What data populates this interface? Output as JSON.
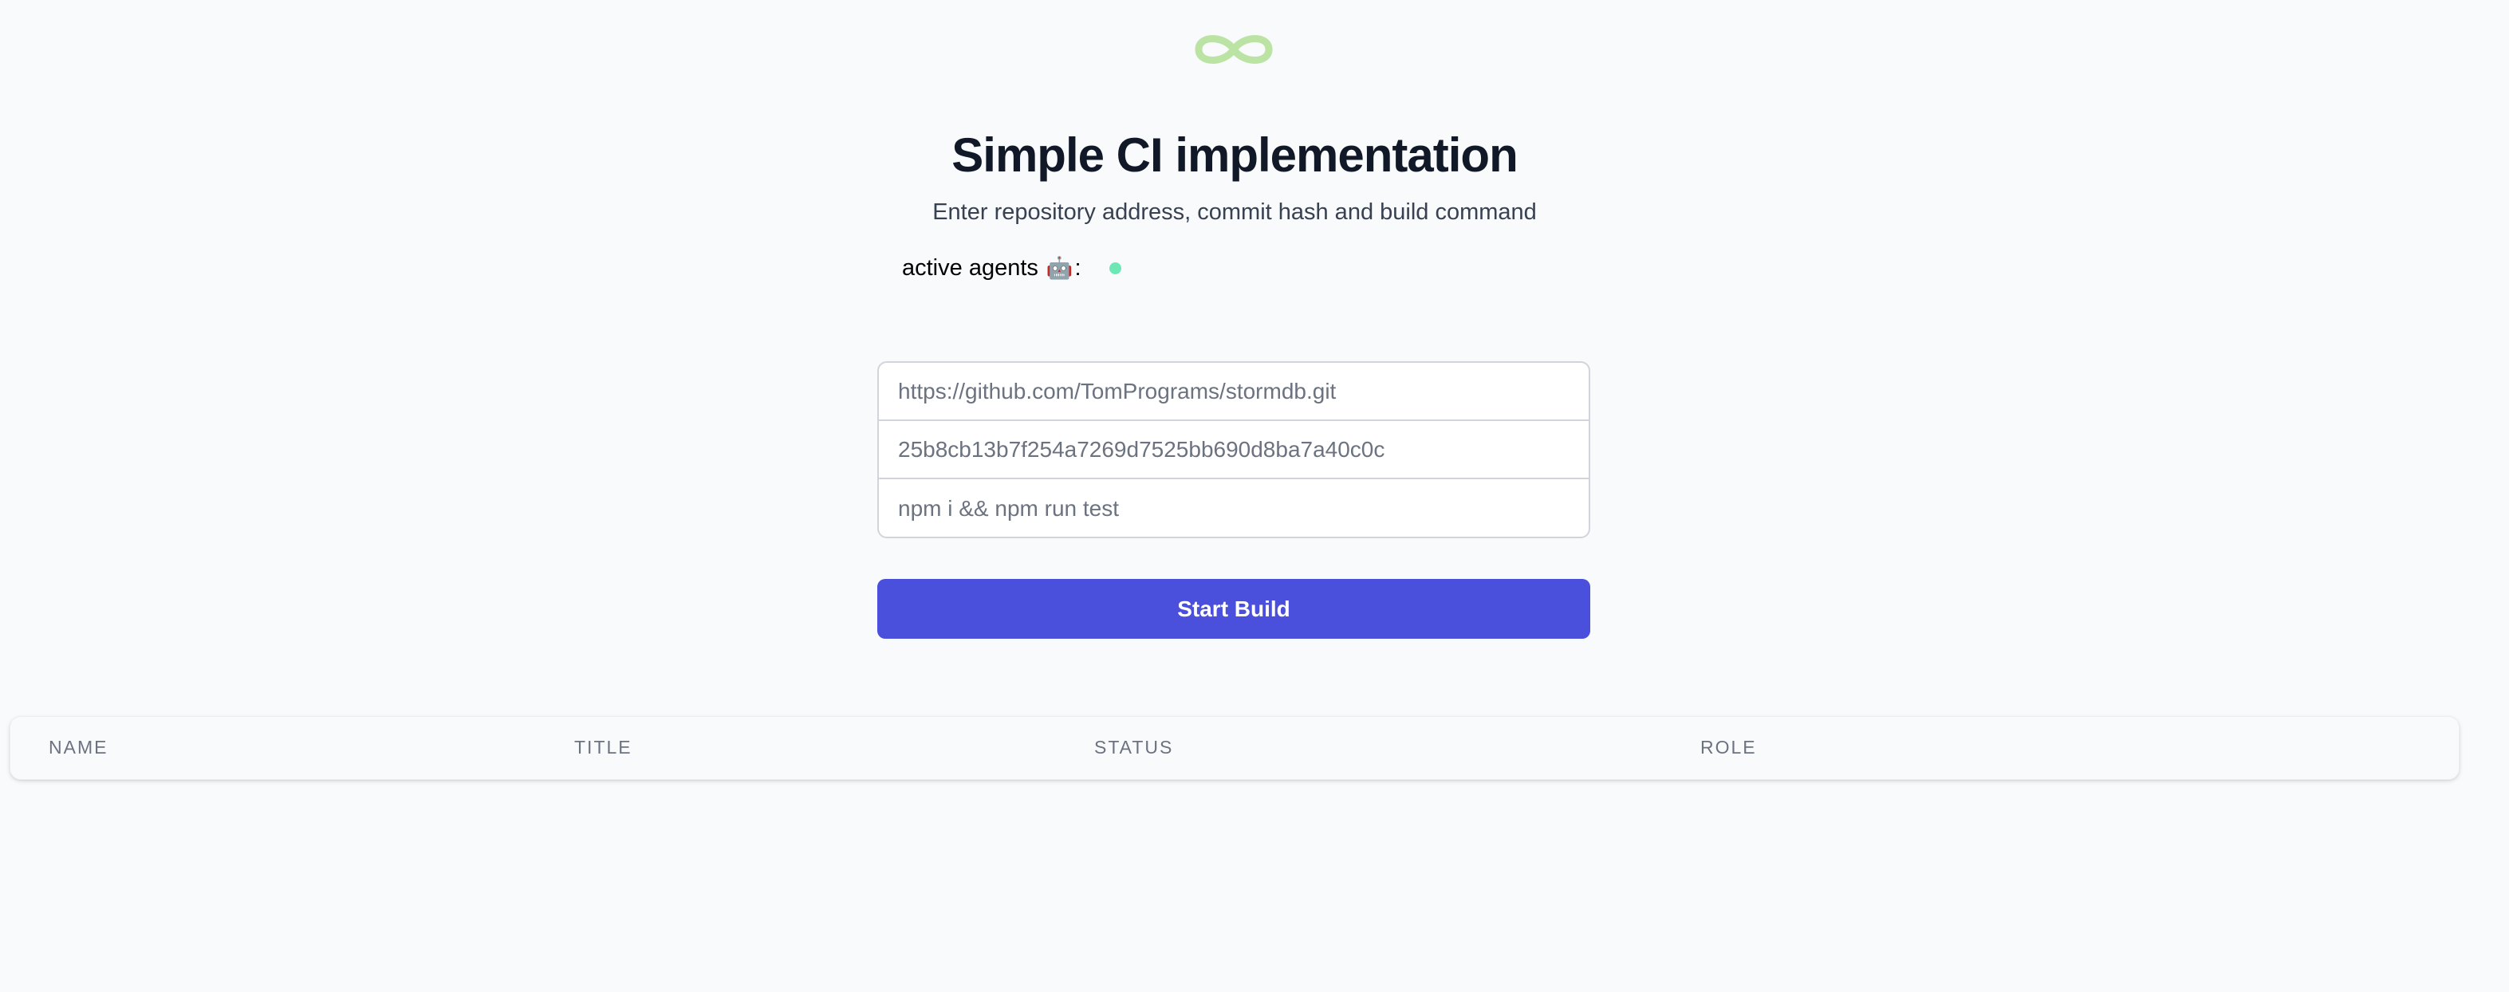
{
  "app": {
    "logo_icon": "infinity-icon",
    "logo_color": "#bbe3a3",
    "title": "Simple CI implementation",
    "subtitle": "Enter repository address, commit hash and build command"
  },
  "agents": {
    "label": "active agents",
    "icon": "robot-icon",
    "icon_glyph": "🤖",
    "separator": ":",
    "indicator_color": "#6ee7b7",
    "active_count_dots": 1
  },
  "form": {
    "repo_url": "https://github.com/TomPrograms/stormdb.git",
    "commit_hash": "25b8cb13b7f254a7269d7525bb690d8ba7a40c0c",
    "build_command": "npm i && npm run test"
  },
  "actions": {
    "start_build_label": "Start Build",
    "accent_color": "#4a4fdc"
  },
  "table": {
    "columns": [
      "Name",
      "Title",
      "Status",
      "Role"
    ],
    "rows": []
  }
}
